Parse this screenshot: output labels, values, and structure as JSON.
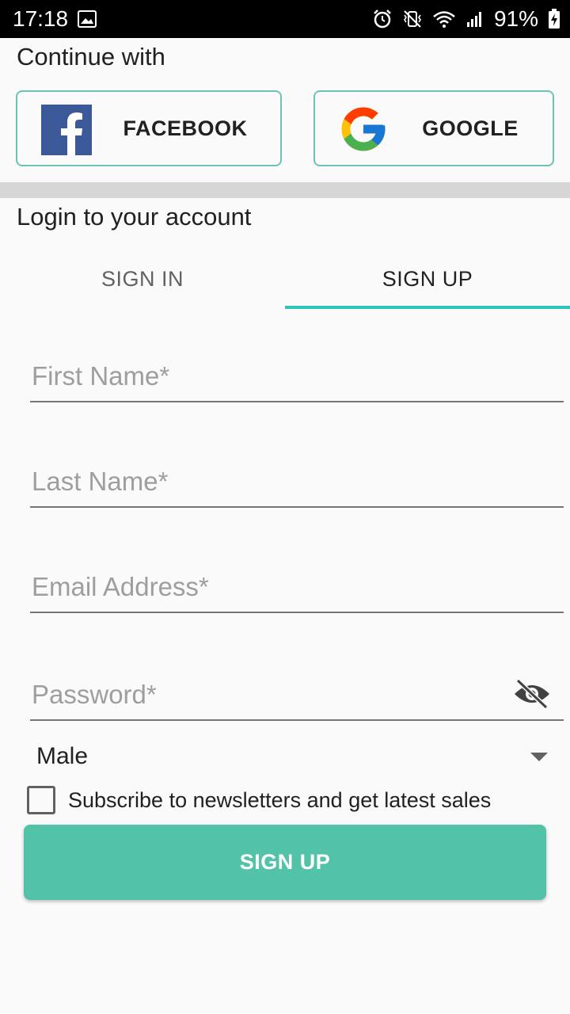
{
  "status_bar": {
    "time": "17:18",
    "battery": "91%",
    "icons": [
      "image-icon",
      "alarm-icon",
      "vibrate-icon",
      "wifi-icon",
      "signal-icon",
      "battery-charging-icon"
    ]
  },
  "social": {
    "title": "Continue with",
    "facebook_label": "FACEBOOK",
    "google_label": "GOOGLE",
    "colors": {
      "border": "#6cc3b1",
      "facebook_blue": "#3b5998"
    }
  },
  "login": {
    "title": "Login to your account",
    "tabs": [
      {
        "label": "SIGN IN",
        "active": false
      },
      {
        "label": "SIGN UP",
        "active": true
      }
    ],
    "accent": "#2ec4b6"
  },
  "form": {
    "first_name_placeholder": "First Name*",
    "last_name_placeholder": "Last Name*",
    "email_placeholder": "Email Address*",
    "password_placeholder": "Password*",
    "gender_value": "Male",
    "subscribe_label": "Subscribe to newsletters and get latest sales",
    "subscribe_checked": false,
    "submit_label": "SIGN UP",
    "submit_color": "#52c2a9"
  }
}
